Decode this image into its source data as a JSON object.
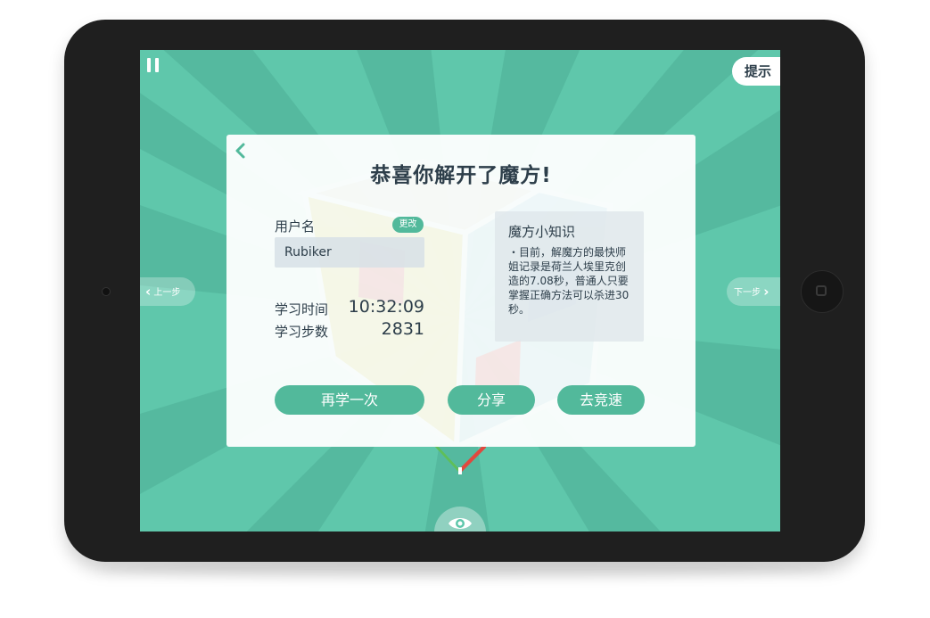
{
  "toolbar": {
    "pause_icon": "pause-icon",
    "hint_label": "提示"
  },
  "nav": {
    "prev_label": "上一步",
    "next_label": "下一步",
    "eye_icon": "eye-icon"
  },
  "dialog": {
    "title": "恭喜你解开了魔方!",
    "back_icon": "chevron-left-icon",
    "username_label": "用户名",
    "change_label": "更改",
    "username_value": "Rubiker",
    "study_time_label": "学习时间",
    "study_time_value": "10:32:09",
    "study_steps_label": "学习步数",
    "study_steps_value": "2831",
    "tip": {
      "title": "魔方小知识",
      "text": "・目前，解魔方的最快师姐记录是荷兰人埃里克创造的7.08秒，普通人只要掌握正确方法可以杀进30秒。"
    },
    "buttons": {
      "again": "再学一次",
      "share": "分享",
      "race": "去竞速"
    }
  },
  "colors": {
    "background_green": "#5fc7ab",
    "button_green": "#52b99b",
    "text_dark": "#2d3e4a",
    "device_frame": "#1f1f1f"
  }
}
